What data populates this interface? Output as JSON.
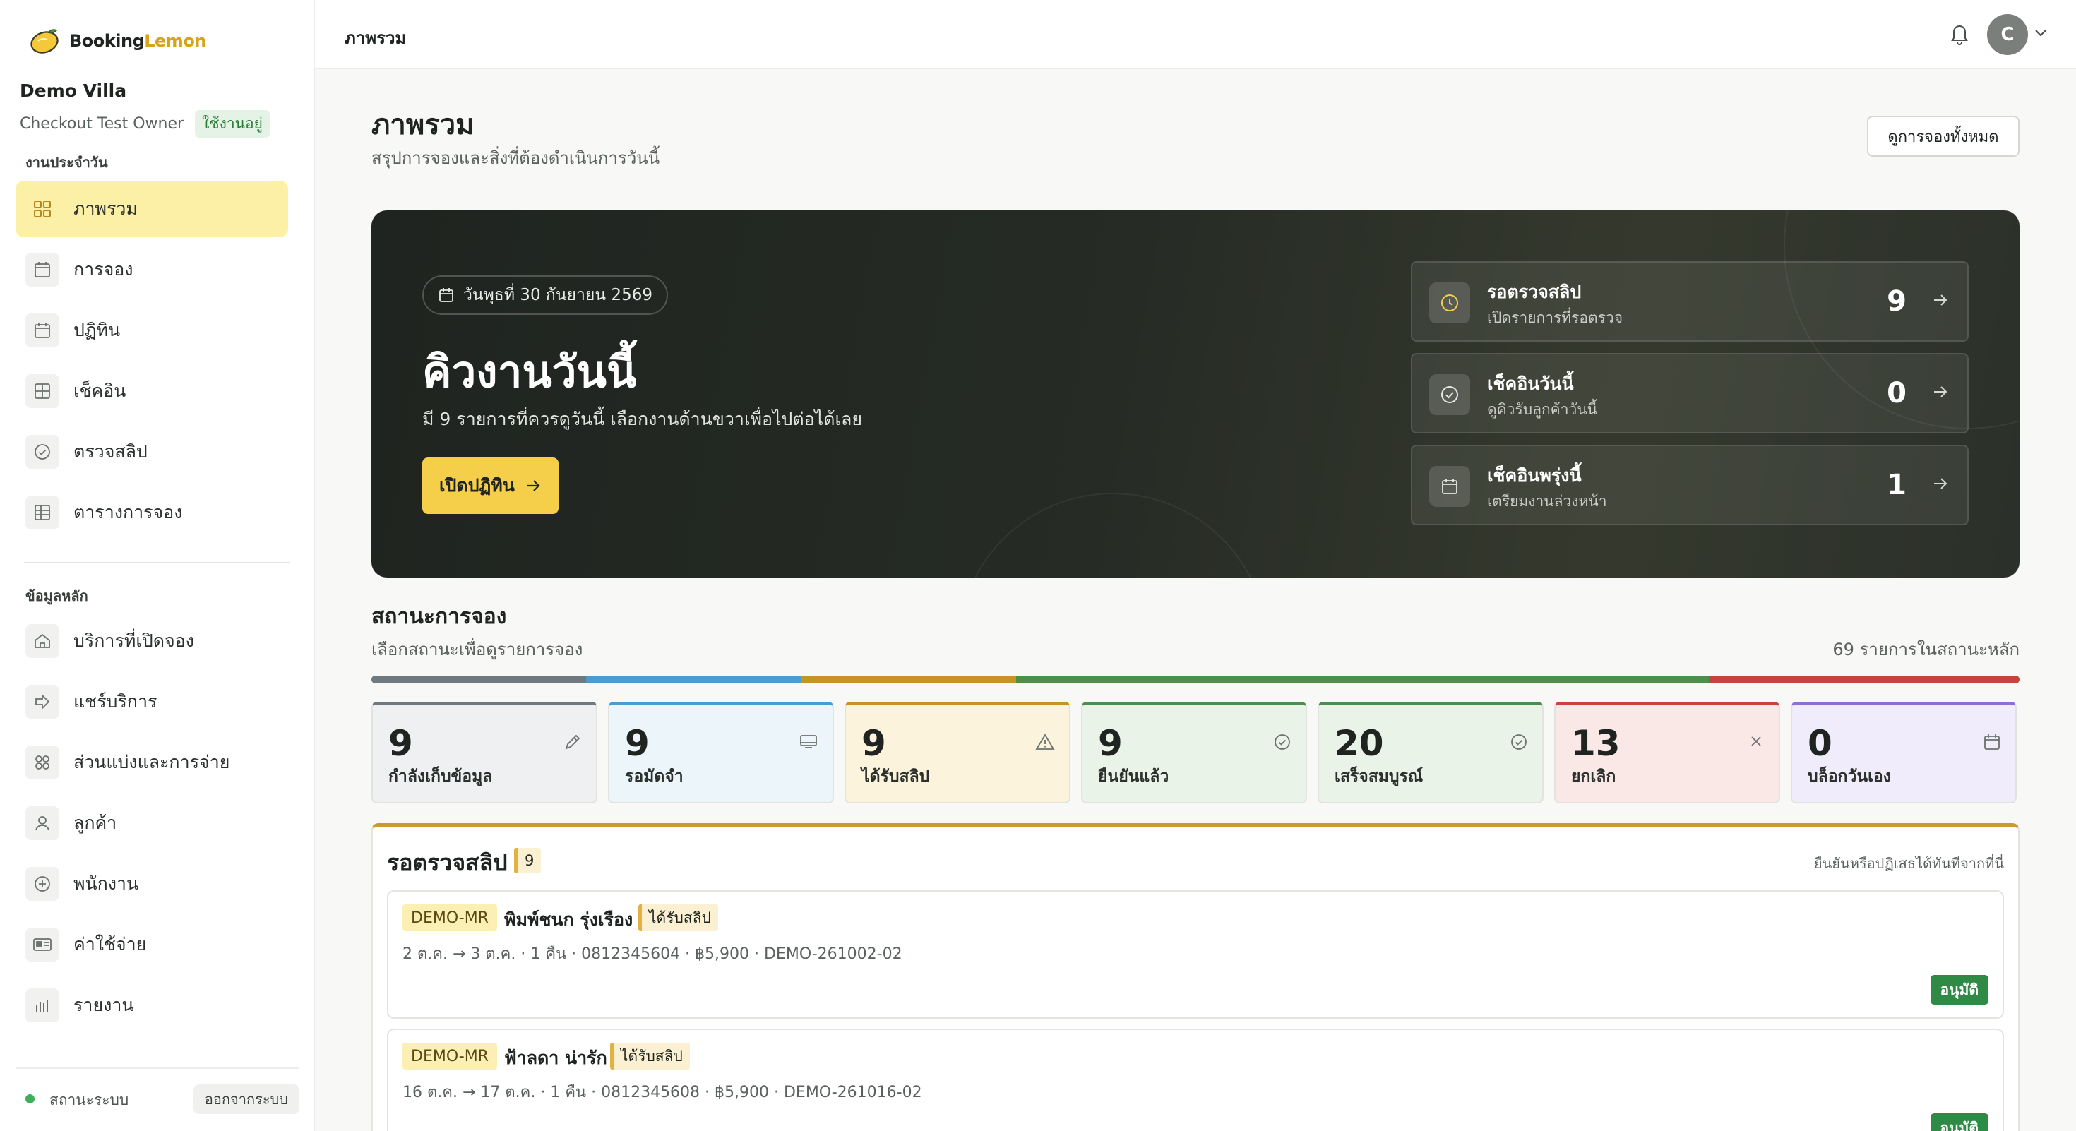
{
  "brand": {
    "name_part1": "Booking",
    "name_part2": "Lemon"
  },
  "property": {
    "name": "Demo Villa",
    "owner": "Checkout Test Owner",
    "status_badge": "ใช้งานอยู่"
  },
  "sidebar": {
    "section_daily": "งานประจำวัน",
    "daily_items": [
      {
        "label": "ภาพรวม",
        "icon": "grid-icon",
        "active": true
      },
      {
        "label": "การจอง",
        "icon": "calendar-icon"
      },
      {
        "label": "ปฏิทิน",
        "icon": "calendar-icon"
      },
      {
        "label": "เช็คอิน",
        "icon": "grid-icon"
      },
      {
        "label": "ตรวจสลิป",
        "icon": "check-circle-icon"
      },
      {
        "label": "ตารางการจอง",
        "icon": "table-icon"
      }
    ],
    "section_master": "ข้อมูลหลัก",
    "master_items": [
      {
        "label": "บริการที่เปิดจอง",
        "icon": "home-icon"
      },
      {
        "label": "แชร์บริการ",
        "icon": "share-icon"
      },
      {
        "label": "ส่วนแบ่งและการจ่าย",
        "icon": "grid-icon"
      },
      {
        "label": "ลูกค้า",
        "icon": "user-icon"
      },
      {
        "label": "พนักงาน",
        "icon": "plus-circle-icon"
      },
      {
        "label": "ค่าใช้จ่าย",
        "icon": "card-icon"
      },
      {
        "label": "รายงาน",
        "icon": "bar-chart-icon"
      }
    ],
    "footer": {
      "status_label": "สถานะระบบ",
      "logout_label": "ออกจากระบบ"
    }
  },
  "topbar": {
    "title": "ภาพรวม",
    "avatar_letter": "C"
  },
  "page": {
    "title": "ภาพรวม",
    "subtitle": "สรุปการจองและสิ่งที่ต้องดำเนินการวันนี้",
    "view_all_button": "ดูการจองทั้งหมด"
  },
  "hero": {
    "date": "วันพุธที่ 30 กันยายน 2569",
    "title": "คิวงานวันนี้",
    "description": "มี 9 รายการที่ควรดูวันนี้ เลือกงานด้านขวาเพื่อไปต่อได้เลย",
    "button": "เปิดปฏิทิน",
    "queue": [
      {
        "title": "รอตรวจสลิป",
        "subtitle": "เปิดรายการที่รอตรวจ",
        "count": "9",
        "icon": "clock-icon"
      },
      {
        "title": "เช็คอินวันนี้",
        "subtitle": "ดูคิวรับลูกค้าวันนี้",
        "count": "0",
        "icon": "check-circle-icon"
      },
      {
        "title": "เช็คอินพรุ่งนี้",
        "subtitle": "เตรียมงานล่วงหน้า",
        "count": "1",
        "icon": "calendar-icon"
      }
    ]
  },
  "status_section": {
    "title": "สถานะการจอง",
    "subtitle": "เลือกสถานะเพื่อดูรายการจอง",
    "total": "69 รายการในสถานะหลัก",
    "colors": {
      "collecting": "#6f7a80",
      "deposit": "#4b9bcf",
      "slip": "#c8922a",
      "confirmed": "#4c8f4a",
      "done": "#4c8f4a",
      "cancelled": "#c8433a",
      "blocked": "#8c6fd0"
    },
    "cards": [
      {
        "count": "9",
        "label": "กำลังเก็บข้อมูล",
        "icon": "pencil-icon",
        "value": 9
      },
      {
        "count": "9",
        "label": "รอมัดจำ",
        "icon": "wallet-icon",
        "value": 9
      },
      {
        "count": "9",
        "label": "ได้รับสลิป",
        "icon": "warning-icon",
        "value": 9
      },
      {
        "count": "9",
        "label": "ยืนยันแล้ว",
        "icon": "check-circle-icon",
        "value": 9
      },
      {
        "count": "20",
        "label": "เสร็จสมบูรณ์",
        "icon": "check-circle-icon",
        "value": 20
      },
      {
        "count": "13",
        "label": "ยกเลิก",
        "icon": "close-icon",
        "value": 13
      },
      {
        "count": "0",
        "label": "บล็อกวันเอง",
        "icon": "calendar-icon",
        "value": 0
      }
    ]
  },
  "review_panel": {
    "title": "รอตรวจสลิป",
    "count": "9",
    "hint": "ยืนยันหรือปฏิเสธได้ทันทีจากที่นี่",
    "bookings": [
      {
        "code": "DEMO-MR",
        "name": "พิมพ์ชนก รุ่งเรือง",
        "tag": "ได้รับสลิป",
        "meta": "2 ต.ค. → 3 ต.ค. · 1 คืน  · 0812345604  · ฿5,900  · DEMO-261002-02",
        "approve": "อนุมัติ"
      },
      {
        "code": "DEMO-MR",
        "name": "ฟ้าลดา น่ารัก",
        "tag": "ได้รับสลิป",
        "meta": "16 ต.ค. → 17 ต.ค. · 1 คืน  · 0812345608  · ฿5,900  · DEMO-261016-02",
        "approve": "อนุมัติ"
      }
    ]
  }
}
